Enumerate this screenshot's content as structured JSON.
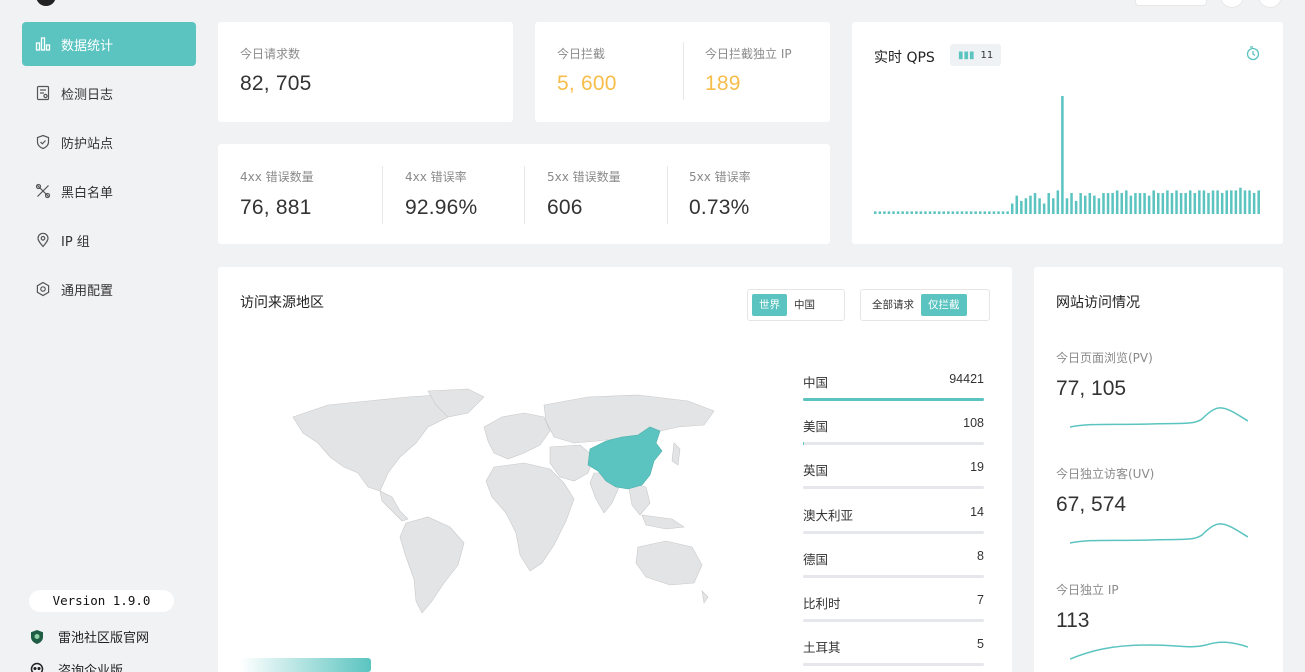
{
  "sidebar": {
    "items": [
      {
        "label": "数据统计",
        "icon": "bar-chart-icon"
      },
      {
        "label": "检测日志",
        "icon": "log-icon"
      },
      {
        "label": "防护站点",
        "icon": "shield-icon"
      },
      {
        "label": "黑白名单",
        "icon": "tools-icon"
      },
      {
        "label": "IP 组",
        "icon": "location-pin-icon"
      },
      {
        "label": "通用配置",
        "icon": "gear-icon"
      }
    ],
    "version": "Version 1.9.0",
    "links": [
      {
        "label": "雷池社区版官网",
        "icon": "community-shield-icon"
      },
      {
        "label": "咨询企业版",
        "icon": "chat-avatar-icon"
      }
    ]
  },
  "stats": {
    "requests": {
      "label": "今日请求数",
      "value": "82, 705"
    },
    "blocked": {
      "label": "今日拦截",
      "value": "5, 600"
    },
    "blocked_ip": {
      "label": "今日拦截独立 IP",
      "value": "189"
    },
    "err4xx_count": {
      "label": "4xx 错误数量",
      "value": "76, 881"
    },
    "err4xx_rate": {
      "label": "4xx 错误率",
      "value": "92.96%"
    },
    "err5xx_count": {
      "label": "5xx 错误数量",
      "value": "606"
    },
    "err5xx_rate": {
      "label": "5xx 错误率",
      "value": "0.73%"
    }
  },
  "qps": {
    "title": "实时 QPS",
    "badge": "11",
    "accent": "#5bc4c0"
  },
  "chart_data": {
    "type": "bar",
    "values": [
      1,
      1,
      1,
      1,
      1,
      1,
      1,
      1,
      1,
      1,
      1,
      1,
      1,
      1,
      1,
      1,
      1,
      1,
      1,
      1,
      1,
      1,
      1,
      1,
      1,
      1,
      1,
      1,
      1,
      1,
      4,
      7,
      5,
      6,
      7,
      8,
      6,
      4,
      8,
      6,
      9,
      45,
      6,
      8,
      5,
      8,
      7,
      8,
      7,
      6,
      8,
      8,
      8,
      9,
      8,
      9,
      7,
      8,
      8,
      8,
      7,
      9,
      8,
      8,
      9,
      8,
      9,
      8,
      8,
      9,
      8,
      9,
      9,
      8,
      9,
      9,
      8,
      9,
      9,
      9,
      10,
      9,
      9,
      8,
      9
    ],
    "grid": false,
    "legend": "none"
  },
  "region": {
    "title": "访问来源地区",
    "scope_options": [
      "世界",
      "中国"
    ],
    "scope_selected": "世界",
    "filter_options": [
      "全部请求",
      "仅拦截"
    ],
    "filter_selected": "仅拦截",
    "rows": [
      {
        "name": "中国",
        "count": "94421",
        "fraction": 1.0
      },
      {
        "name": "美国",
        "count": "108",
        "fraction": 0.0011
      },
      {
        "name": "英国",
        "count": "19",
        "fraction": 0.0002
      },
      {
        "name": "澳大利亚",
        "count": "14",
        "fraction": 0.0001
      },
      {
        "name": "德国",
        "count": "8",
        "fraction": 0.0001
      },
      {
        "name": "比利时",
        "count": "7",
        "fraction": 0.0001
      },
      {
        "name": "土耳其",
        "count": "5",
        "fraction": 0.0001
      }
    ],
    "highlight_color": "#5bc4c0"
  },
  "site": {
    "title": "网站访问情况",
    "pv": {
      "label": "今日页面浏览(PV)",
      "value": "77, 105"
    },
    "uv": {
      "label": "今日独立访客(UV)",
      "value": "67, 574"
    },
    "ip": {
      "label": "今日独立 IP",
      "value": "113"
    }
  }
}
